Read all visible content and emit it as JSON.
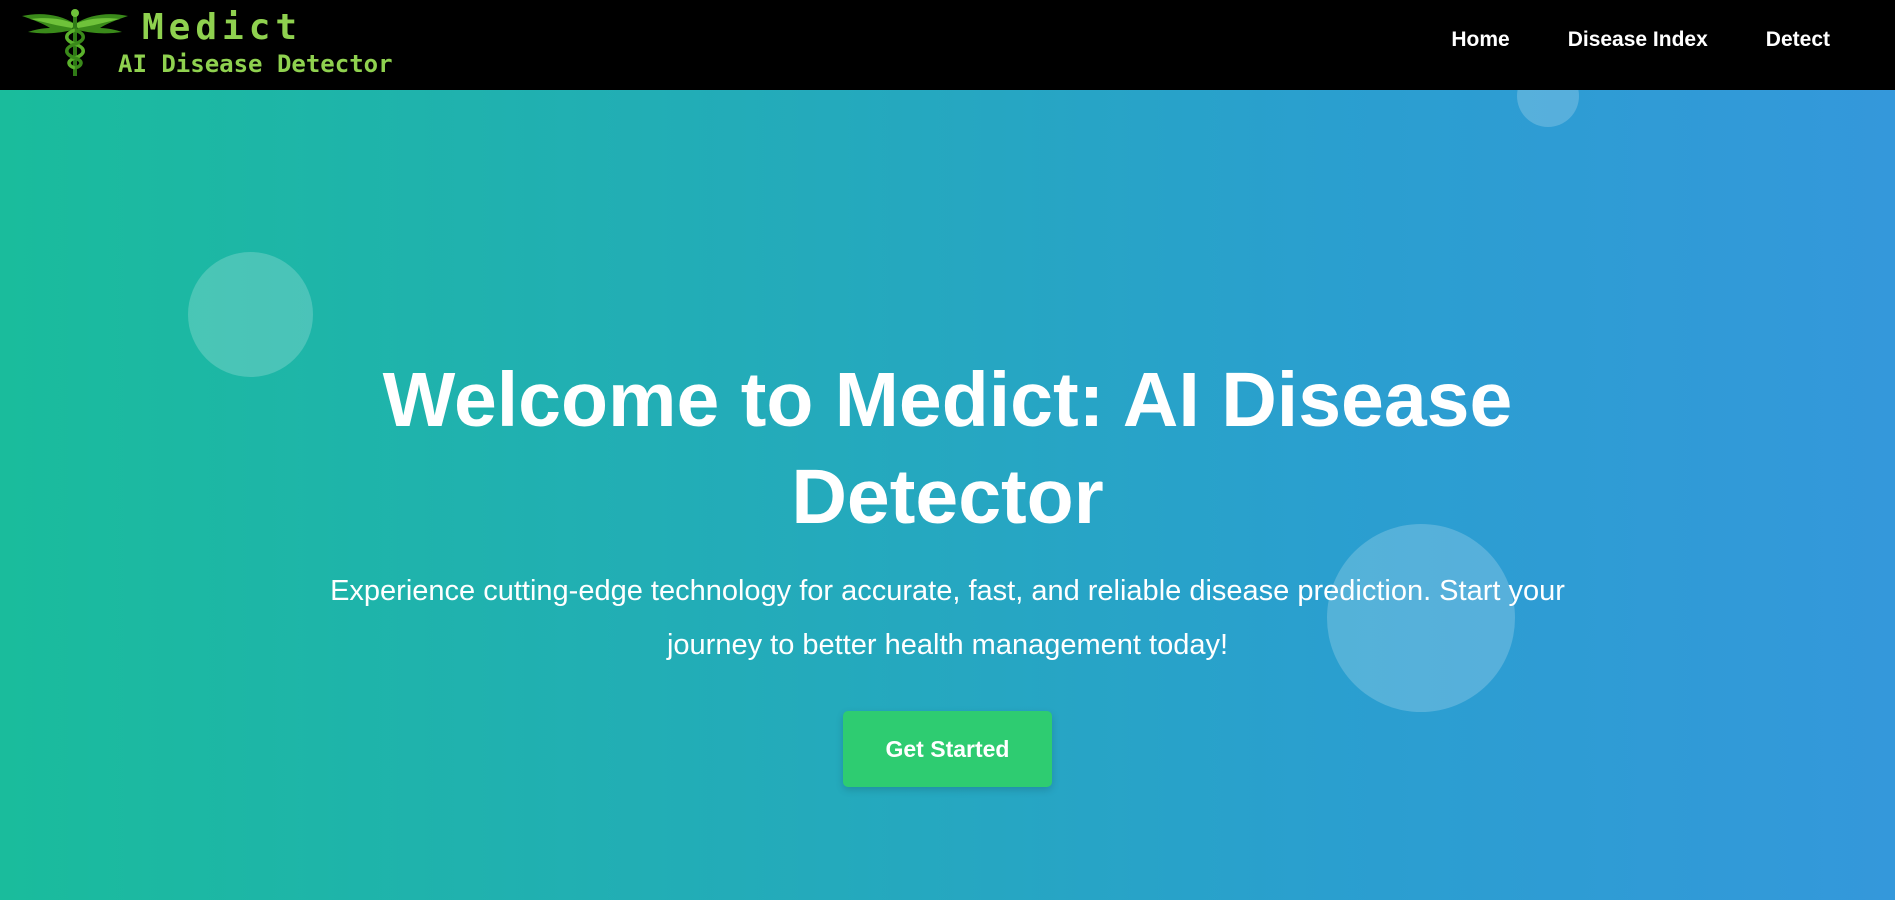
{
  "brand": {
    "title": "Medict",
    "subtitle": "AI Disease Detector",
    "color": "#8fd14f"
  },
  "nav": {
    "items": [
      {
        "label": "Home"
      },
      {
        "label": "Disease Index"
      },
      {
        "label": "Detect"
      }
    ]
  },
  "hero": {
    "title": "Welcome to Medict: AI Disease Detector",
    "subtitle": "Experience cutting-edge technology for accurate, fast, and reliable disease prediction. Start your journey to better health management today!",
    "cta_label": "Get Started",
    "gradient_start": "#1abc9c",
    "gradient_end": "#3498db",
    "cta_color": "#2ecc71"
  },
  "icons": {
    "logo": "caduceus-icon"
  }
}
